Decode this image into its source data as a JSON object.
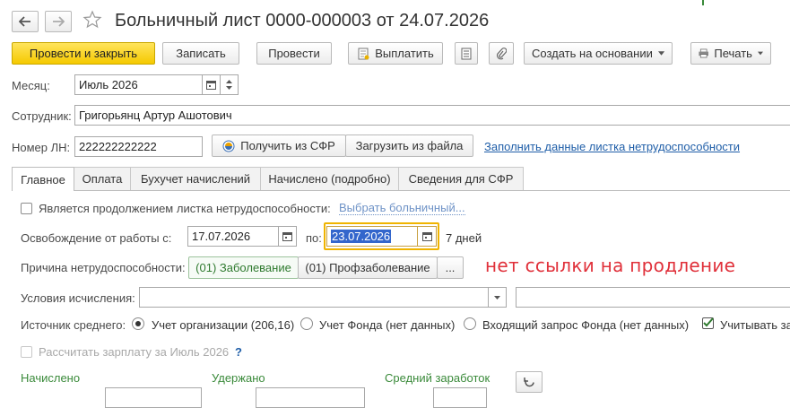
{
  "window": {
    "title": "Больничный лист 0000-000003 от 24.07.2026"
  },
  "toolbar": {
    "post_and_close": "Провести и закрыть",
    "save": "Записать",
    "post": "Провести",
    "pay": "Выплатить",
    "create_based_on": "Создать на основании",
    "print": "Печать"
  },
  "header": {
    "month_label": "Месяц:",
    "month_value": "Июль 2026",
    "employee_label": "Сотрудник:",
    "employee_value": "Григорьянц Артур Ашотович",
    "ln_label": "Номер ЛН:",
    "ln_value": "222222222222",
    "get_from_sfr": "Получить из СФР",
    "load_from_file": "Загрузить из файла",
    "fill_link": "Заполнить данные листка нетрудоспособности"
  },
  "tabs": [
    {
      "label": "Главное",
      "active": true
    },
    {
      "label": "Оплата"
    },
    {
      "label": "Бухучет начислений"
    },
    {
      "label": "Начислено (подробно)"
    },
    {
      "label": "Сведения для СФР"
    }
  ],
  "main": {
    "continuation_label": "Является продолжением листка нетрудоспособности:",
    "choose_link": "Выбрать больничный...",
    "release_label": "Освобождение от работы с:",
    "release_from": "17.07.2026",
    "to_label": "по:",
    "release_to": "23.07.2026",
    "days_text": "7 дней",
    "reason_label": "Причина нетрудоспособности:",
    "reason_selected": "(01) Заболевание",
    "reason_other": "(01) Профзаболевание",
    "more_button": "...",
    "annotation": "нет ссылки на продление",
    "conditions_label": "Условия исчисления:",
    "source_label": "Источник среднего:",
    "source_org": "Учет организации (206,16)",
    "source_fund": "Учет Фонда (нет данных)",
    "source_request": "Входящий запрос Фонда (нет данных)",
    "consider_label": "Учитывать за",
    "calc_salary_label": "Рассчитать зарплату за Июль 2026",
    "help_mark": "?",
    "accrued_label": "Начислено",
    "withheld_label": "Удержано",
    "avg_earnings_label": "Средний заработок"
  },
  "colors": {
    "primary_button": "#f5c900",
    "link": "#1f5ea8",
    "annotation": "#e0303a",
    "focus_border": "#f0b400",
    "selection": "#3366cc",
    "section_green": "#3a8a3a"
  }
}
